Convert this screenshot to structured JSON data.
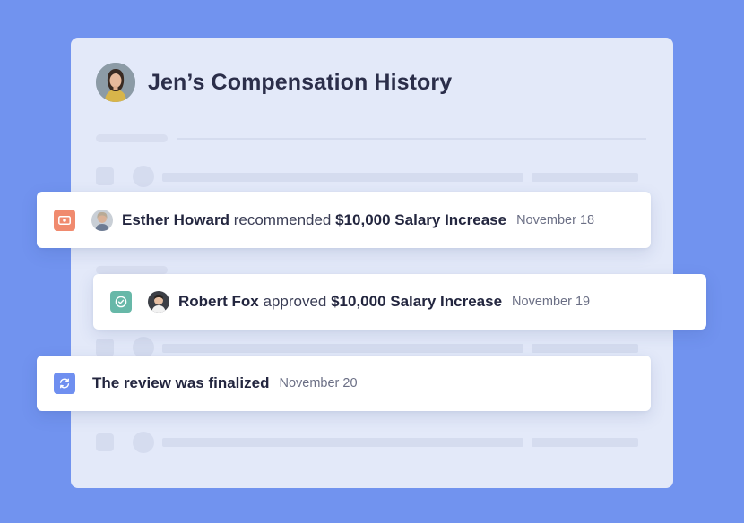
{
  "page": {
    "title": "Jen’s Compensation History",
    "background_color": "#7193ef"
  },
  "events": [
    {
      "actor": "Esther Howard",
      "verb": "recommended",
      "subject": "$10,000 Salary Increase",
      "date": "November 18",
      "icon": "money-icon",
      "icon_color": "#f08a6e"
    },
    {
      "actor": "Robert Fox",
      "verb": "approved",
      "subject": "$10,000 Salary Increase",
      "date": "November 19",
      "icon": "check-circle-icon",
      "icon_color": "#67b8a8"
    },
    {
      "text": "The review was finalized",
      "date": "November 20",
      "icon": "refresh-icon",
      "icon_color": "#6f8ff0"
    }
  ]
}
